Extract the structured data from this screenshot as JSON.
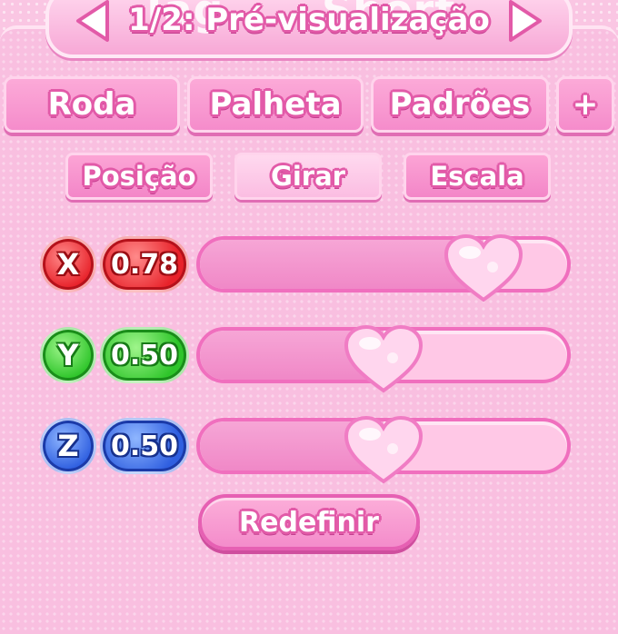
{
  "header": {
    "title": "1/2: Pré-visualização",
    "ghost_left": "Tag",
    "ghost_right": "Short"
  },
  "tabs": [
    {
      "label": "Roda"
    },
    {
      "label": "Palheta"
    },
    {
      "label": "Padrões"
    },
    {
      "label": "+"
    }
  ],
  "subtabs": [
    {
      "label": "Posição",
      "active": false
    },
    {
      "label": "Girar",
      "active": true
    },
    {
      "label": "Escala",
      "active": false
    }
  ],
  "axes": [
    {
      "axis": "X",
      "value_label": "0.78",
      "value": 0.78,
      "color": "#e8222a"
    },
    {
      "axis": "Y",
      "value_label": "0.50",
      "value": 0.5,
      "color": "#2ec52a"
    },
    {
      "axis": "Z",
      "value_label": "0.50",
      "value": 0.5,
      "color": "#2f5fe0"
    }
  ],
  "reset_label": "Redefinir",
  "colors": {
    "accent": "#f06fbe",
    "background": "#fac6e3"
  },
  "icons": {
    "prev": "chevron-left-icon",
    "next": "chevron-right-icon",
    "slider_handle": "heart-icon"
  }
}
